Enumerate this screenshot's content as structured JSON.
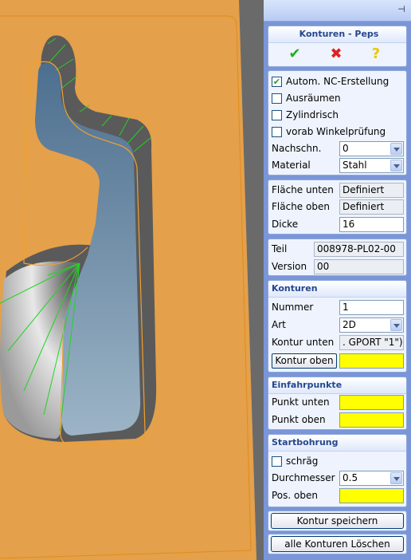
{
  "panel": {
    "title": "Konturen - Peps",
    "pin_icon": "pin-icon",
    "actions": {
      "ok_icon": "checkmark-icon",
      "cancel_icon": "red-x-icon",
      "help_icon": "question-icon"
    },
    "options": [
      {
        "label": "Autom. NC-Erstellung",
        "checked": true
      },
      {
        "label": "Ausräumen",
        "checked": false
      },
      {
        "label": "Zylindrisch",
        "checked": false
      },
      {
        "label": "vorab Winkelprüfung",
        "checked": false
      }
    ],
    "nachschn": {
      "label": "Nachschn.",
      "value": "0"
    },
    "material": {
      "label": "Material",
      "value": "Stahl"
    },
    "flaeche_unten": {
      "label": "Fläche unten",
      "value": "Definiert"
    },
    "flaeche_oben": {
      "label": "Fläche oben",
      "value": "Definiert"
    },
    "dicke": {
      "label": "Dicke",
      "value": "16"
    },
    "teil": {
      "label": "Teil",
      "value": "008978-PL02-00"
    },
    "version": {
      "label": "Version",
      "value": "00"
    },
    "konturen": {
      "header": "Konturen",
      "nummer": {
        "label": "Nummer",
        "value": "1"
      },
      "art": {
        "label": "Art",
        "value": "2D"
      },
      "kontur_unten": {
        "label": "Kontur unten",
        "value": ". GPORT \"1\")"
      },
      "kontur_oben_button": "Kontur oben"
    },
    "einfahrpunkte": {
      "header": "Einfahrpunkte",
      "punkt_unten": {
        "label": "Punkt unten"
      },
      "punkt_oben": {
        "label": "Punkt oben"
      }
    },
    "startbohrung": {
      "header": "Startbohrung",
      "schraeg": {
        "label": "schräg",
        "checked": false
      },
      "durchmesser": {
        "label": "Durchmesser",
        "value": "0.5"
      },
      "pos_oben": {
        "label": "Pos. oben"
      }
    },
    "save_button": "Kontur speichern",
    "delete_button": "alle Konturen Löschen"
  },
  "colors": {
    "panel_bg": "#7a96d8",
    "plate": "#e4a04a",
    "highlight_yellow": "#ffff00",
    "contour_orange": "#f0a030",
    "edge_green": "#22d422"
  }
}
